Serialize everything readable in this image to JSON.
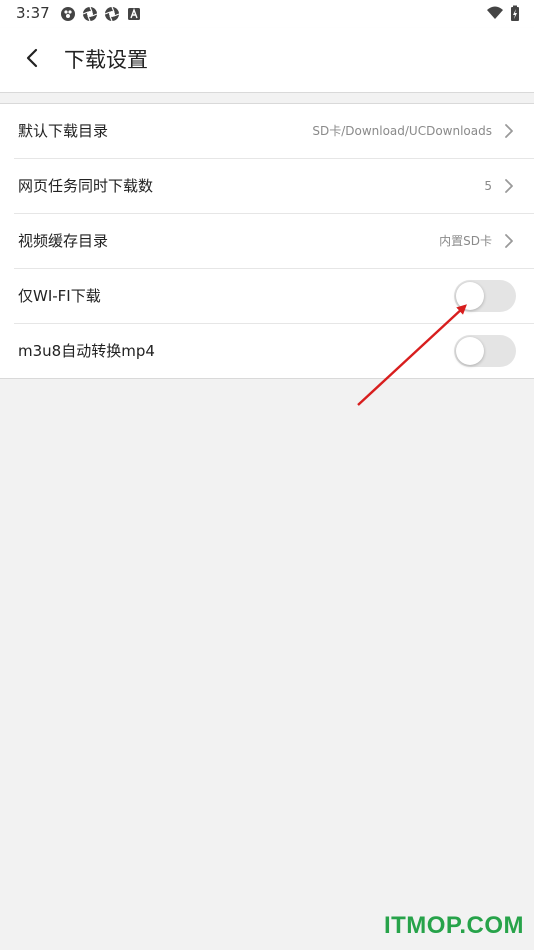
{
  "status_bar": {
    "time": "3:37",
    "left_icons": [
      "paw-icon",
      "aperture-icon",
      "aperture-icon",
      "font-a-icon"
    ],
    "right_icons": [
      "wifi-icon",
      "battery-charging-icon"
    ]
  },
  "header": {
    "back_icon": "chevron-left-icon",
    "title": "下载设置"
  },
  "settings": [
    {
      "label": "默认下载目录",
      "value": "SD卡/Download/UCDownloads",
      "type": "link"
    },
    {
      "label": "网页任务同时下载数",
      "value": "5",
      "type": "link"
    },
    {
      "label": "视频缓存目录",
      "value": "内置SD卡",
      "type": "link"
    },
    {
      "label": "仅WI-FI下载",
      "type": "toggle",
      "on": false
    },
    {
      "label": "m3u8自动转换mp4",
      "type": "toggle",
      "on": false
    }
  ],
  "colors": {
    "arrow": "#d81e1e",
    "toggle_off_track": "#e4e4e4",
    "watermark": "#27a34a"
  },
  "watermark": "ITMOP.COM"
}
